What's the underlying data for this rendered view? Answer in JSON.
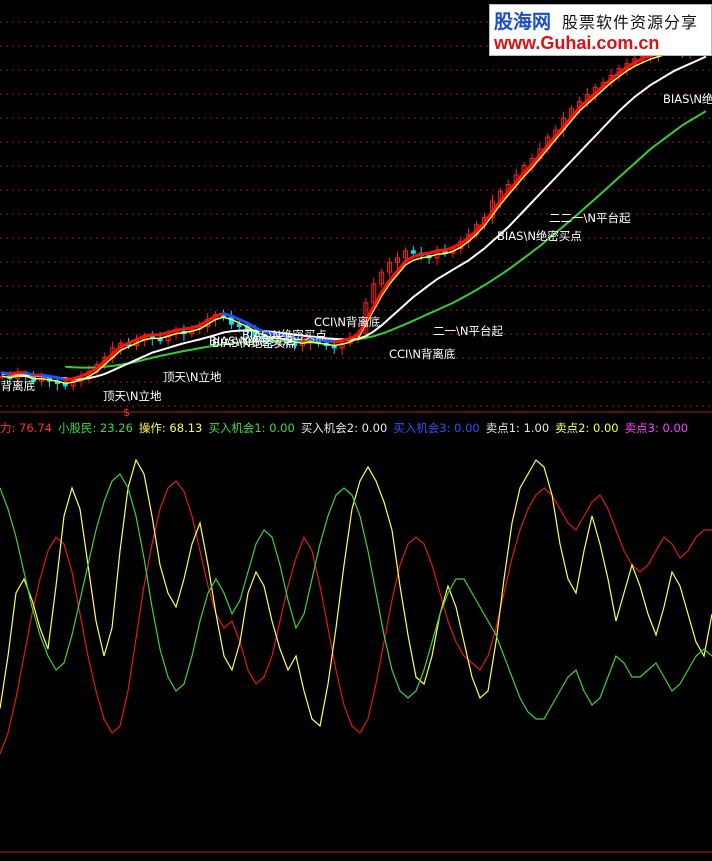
{
  "watermark": {
    "brand": "股海网",
    "slogan": "股票软件资源分享",
    "url": "www.Guhai.com.cn"
  },
  "price_annotations": [
    {
      "text": "N背离底",
      "color": "#ffffff"
    },
    {
      "text": "顶天\\N立地",
      "color": "#ffffff"
    },
    {
      "text": "顶天\\N立地",
      "color": "#ffffff"
    },
    {
      "text": "BIAS\\N绝密买点",
      "color": "#ffffff"
    },
    {
      "text": "BIAS\\N绝密买点",
      "color": "#ffffff"
    },
    {
      "text": "BIAS\\N绝密买点",
      "color": "#ffffff"
    },
    {
      "text": "CCI\\N背离底",
      "color": "#ffffff"
    },
    {
      "text": "CCI\\N背离底",
      "color": "#ffffff"
    },
    {
      "text": "二一\\N平台起",
      "color": "#ffffff"
    },
    {
      "text": "BIAS\\N绝密买点",
      "color": "#ffffff"
    },
    {
      "text": "二二一\\N平台起",
      "color": "#ffffff"
    },
    {
      "text": "BIAS\\N绝",
      "color": "#ffffff"
    },
    {
      "text": "$",
      "color": "#ff3030"
    }
  ],
  "indicator_bar": [
    {
      "label": "力:",
      "value": "76.74",
      "color": "#ff3030"
    },
    {
      "label": "小股民:",
      "value": "23.26",
      "color": "#3cdc3c"
    },
    {
      "label": "操作:",
      "value": "68.13",
      "color": "#ffff40"
    },
    {
      "label": "买入机会1:",
      "value": "0.00",
      "color": "#3cdc3c"
    },
    {
      "label": "买入机会2:",
      "value": "0.00",
      "color": "#e8e8e8"
    },
    {
      "label": "买入机会3:",
      "value": "0.00",
      "color": "#3050ff"
    },
    {
      "label": "卖点1:",
      "value": "1.00",
      "color": "#e8e8e8"
    },
    {
      "label": "卖点2:",
      "value": "0.00",
      "color": "#ffff40"
    },
    {
      "label": "卖点3:",
      "value": "0.00",
      "color": "#ff40ff"
    }
  ],
  "colors": {
    "background": "#000000",
    "grid": "#8b1a1a",
    "candle_up": "#ff2020",
    "candle_down": "#00e5ff",
    "ma_red": "#ff1010",
    "ma_blue": "#2050ff",
    "ma_yellow": "#ffff40",
    "ma_white": "#ffffff",
    "ma_green": "#30d030",
    "osc_red": "#e01818",
    "osc_yellow": "#ffff50",
    "osc_green": "#40d040"
  },
  "chart_data": [
    {
      "type": "line",
      "panel": "price",
      "x": [
        0,
        1,
        2,
        3,
        4,
        5,
        6,
        7,
        8,
        9,
        10,
        11,
        12,
        13,
        14,
        15,
        16,
        17,
        18,
        19,
        20,
        21,
        22,
        23,
        24,
        25,
        26,
        27,
        28,
        29,
        30,
        31,
        32,
        33,
        34,
        35,
        36,
        37,
        38,
        39,
        40,
        41,
        42,
        43,
        44,
        45,
        46,
        47,
        48,
        49,
        50,
        51,
        52,
        53,
        54,
        55,
        56,
        57,
        58,
        59,
        60,
        61,
        62,
        63,
        64,
        65,
        66,
        67,
        68,
        69,
        70,
        71,
        72,
        73,
        74,
        75,
        76,
        77,
        78,
        79,
        80,
        81,
        82,
        83,
        84,
        85,
        86,
        87,
        88,
        89
      ],
      "series": [
        {
          "role": "close",
          "values": [
            74,
            73,
            75,
            74,
            72,
            73,
            72,
            71,
            70,
            72,
            74,
            76,
            79,
            82,
            86,
            88,
            87,
            89,
            91,
            90,
            89,
            92,
            93,
            92,
            94,
            95,
            98,
            100,
            99,
            96,
            95,
            93,
            91,
            90,
            89,
            90,
            88,
            87,
            88,
            89,
            88,
            87,
            86,
            88,
            90,
            92,
            105,
            113,
            118,
            122,
            124,
            127,
            126,
            125,
            124,
            127,
            126,
            128,
            131,
            134,
            138,
            141,
            148,
            152,
            155,
            159,
            163,
            166,
            170,
            175,
            178,
            183,
            187,
            190,
            193,
            196,
            198,
            201,
            204,
            206,
            208,
            209,
            210,
            211,
            212,
            213,
            211,
            212,
            213,
            214
          ]
        },
        {
          "role": "ma_short",
          "values": [
            74,
            73.5,
            74,
            74,
            73,
            73,
            72.5,
            72,
            71,
            71.5,
            72.5,
            74,
            76,
            79,
            82,
            85,
            86.5,
            88,
            89.5,
            90,
            90,
            91,
            92,
            92.5,
            93,
            94,
            96,
            98,
            99,
            98,
            96.5,
            95,
            93,
            91.5,
            90.5,
            90,
            89.5,
            88.5,
            88,
            88.5,
            88,
            87.5,
            87,
            87.5,
            88.5,
            90,
            96,
            102,
            108,
            113,
            117,
            121,
            123,
            124,
            124.5,
            125.5,
            125.8,
            126.8,
            128.5,
            131,
            134,
            137.5,
            142,
            146.5,
            150.5,
            154.5,
            158.5,
            162,
            166,
            170,
            174,
            178,
            182,
            186,
            189,
            192,
            195,
            198,
            200.5,
            203,
            205,
            206.5,
            208,
            209,
            210,
            211,
            211,
            211.5,
            212,
            212.5
          ]
        },
        {
          "role": "ma_mid",
          "values": [
            75,
            74.8,
            74.6,
            74.4,
            74.2,
            74,
            73.7,
            73.4,
            73.1,
            72.8,
            72.8,
            73.2,
            74,
            75,
            76.5,
            78,
            79.5,
            81,
            82.5,
            84,
            85,
            86,
            87,
            88,
            88.8,
            89.6,
            90.5,
            91.5,
            92.5,
            93,
            93.3,
            93.4,
            93.3,
            93.1,
            92.8,
            92.4,
            92,
            91.6,
            91.2,
            90.8,
            90.4,
            90,
            89.8,
            89.6,
            89.6,
            89.8,
            91,
            93,
            95.5,
            98.5,
            101.5,
            104.5,
            107.5,
            110,
            112.5,
            115,
            117,
            119,
            121,
            123,
            125.5,
            128,
            131,
            134,
            137,
            140.5,
            144,
            147.5,
            151,
            154.5,
            158,
            161.5,
            165,
            168.5,
            172,
            175.5,
            179,
            182.5,
            186,
            189,
            192,
            194.5,
            197,
            199,
            201,
            203,
            204.5,
            206,
            207.5,
            209
          ]
        },
        {
          "role": "ma_long",
          "values": [
            null,
            null,
            null,
            null,
            null,
            null,
            null,
            null,
            78,
            77.8,
            77.7,
            77.7,
            77.8,
            78,
            78.4,
            78.9,
            79.5,
            80.2,
            81,
            81.8,
            82.6,
            83.3,
            84,
            84.7,
            85.3,
            85.9,
            86.5,
            87.1,
            87.6,
            88,
            88.3,
            88.5,
            88.7,
            88.8,
            88.9,
            89,
            89,
            89,
            89,
            89,
            89,
            89,
            89,
            89.1,
            89.3,
            89.6,
            90.2,
            91,
            92,
            93.2,
            94.6,
            96,
            97.5,
            99,
            100.5,
            102,
            103.5,
            105,
            106.8,
            108.6,
            110.5,
            112.5,
            114.6,
            116.8,
            119,
            121.5,
            124,
            126.5,
            129,
            131.8,
            134.6,
            137.4,
            140.2,
            143,
            146,
            149,
            152,
            155,
            158,
            161,
            164,
            167,
            170,
            172.5,
            175,
            177.5,
            180,
            182,
            184,
            186
          ]
        },
        {
          "role": "ma_extra",
          "values": [
            null,
            null,
            null,
            null,
            null,
            null,
            null,
            null,
            null,
            null,
            null,
            null,
            null,
            null,
            null,
            null,
            null,
            null,
            null,
            null,
            null,
            null,
            null,
            null,
            null,
            null,
            null,
            null,
            null,
            null,
            null,
            null,
            null,
            null,
            null,
            null,
            null,
            null,
            null,
            null,
            null,
            null,
            null,
            null,
            null,
            null,
            null,
            null,
            null,
            null,
            null,
            null,
            null,
            null,
            null,
            null,
            null,
            null,
            null,
            null,
            null,
            null,
            null,
            null,
            null,
            null,
            null,
            null,
            null,
            null,
            null,
            null,
            null,
            null,
            null,
            null,
            null,
            null,
            null,
            null,
            null,
            null,
            null,
            null,
            null,
            null,
            null,
            null,
            null,
            null
          ]
        }
      ]
    },
    {
      "type": "line",
      "panel": "oscillator",
      "ylim": [
        0,
        100
      ],
      "x": [
        0,
        1,
        2,
        3,
        4,
        5,
        6,
        7,
        8,
        9,
        10,
        11,
        12,
        13,
        14,
        15,
        16,
        17,
        18,
        19,
        20,
        21,
        22,
        23,
        24,
        25,
        26,
        27,
        28,
        29,
        30,
        31,
        32,
        33,
        34,
        35,
        36,
        37,
        38,
        39,
        40,
        41,
        42,
        43,
        44,
        45,
        46,
        47,
        48,
        49,
        50,
        51,
        52,
        53,
        54,
        55,
        56,
        57,
        58,
        59,
        60,
        61,
        62,
        63,
        64,
        65,
        66,
        67,
        68,
        69,
        70,
        71,
        72,
        73,
        74,
        75,
        76,
        77,
        78,
        79,
        80,
        81,
        82,
        83,
        84,
        85,
        86,
        87,
        88,
        89
      ],
      "series": [
        {
          "role": "red",
          "values": [
            12,
            18,
            28,
            40,
            52,
            62,
            70,
            74,
            72,
            64,
            52,
            40,
            30,
            22,
            18,
            20,
            30,
            45,
            60,
            72,
            82,
            88,
            90,
            87,
            80,
            70,
            60,
            52,
            48,
            50,
            44,
            36,
            32,
            34,
            40,
            50,
            60,
            68,
            74,
            70,
            60,
            48,
            36,
            26,
            20,
            18,
            22,
            32,
            44,
            56,
            66,
            72,
            74,
            72,
            66,
            58,
            50,
            44,
            40,
            38,
            36,
            40,
            48,
            58,
            68,
            76,
            82,
            86,
            88,
            86,
            82,
            78,
            76,
            80,
            84,
            86,
            82,
            76,
            70,
            66,
            64,
            66,
            70,
            74,
            72,
            68,
            70,
            74,
            76,
            76
          ]
        },
        {
          "role": "yellow",
          "values": [
            25,
            40,
            58,
            62,
            56,
            48,
            42,
            60,
            80,
            88,
            82,
            66,
            50,
            40,
            48,
            70,
            88,
            96,
            92,
            80,
            66,
            58,
            54,
            62,
            72,
            78,
            66,
            52,
            40,
            36,
            44,
            58,
            64,
            60,
            50,
            42,
            36,
            40,
            30,
            22,
            20,
            32,
            48,
            66,
            82,
            90,
            94,
            90,
            84,
            76,
            60,
            46,
            34,
            32,
            40,
            52,
            60,
            54,
            44,
            34,
            28,
            30,
            44,
            62,
            78,
            88,
            92,
            96,
            94,
            86,
            72,
            62,
            58,
            70,
            80,
            72,
            62,
            50,
            58,
            66,
            60,
            52,
            46,
            54,
            64,
            60,
            52,
            44,
            40,
            52
          ]
        },
        {
          "role": "green",
          "values": [
            88,
            82,
            74,
            64,
            54,
            46,
            40,
            36,
            38,
            46,
            56,
            66,
            76,
            84,
            90,
            92,
            88,
            80,
            68,
            54,
            42,
            34,
            30,
            32,
            40,
            50,
            58,
            62,
            58,
            52,
            56,
            64,
            72,
            76,
            74,
            66,
            56,
            48,
            52,
            62,
            72,
            80,
            86,
            88,
            86,
            80,
            70,
            58,
            46,
            36,
            30,
            28,
            30,
            36,
            44,
            52,
            58,
            62,
            62,
            58,
            54,
            50,
            46,
            40,
            34,
            28,
            24,
            22,
            22,
            26,
            30,
            34,
            36,
            30,
            26,
            28,
            34,
            40,
            38,
            34,
            34,
            36,
            38,
            34,
            30,
            32,
            36,
            40,
            42,
            40
          ]
        }
      ]
    }
  ]
}
